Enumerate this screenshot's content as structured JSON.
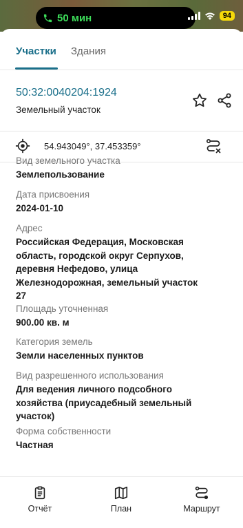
{
  "status_bar": {
    "call_time": "50 мин",
    "battery": "94"
  },
  "tabs": [
    {
      "label": "Участки",
      "active": true
    },
    {
      "label": "Здания",
      "active": false
    }
  ],
  "parcel": {
    "cadastral_number": "50:32:0040204:1924",
    "type": "Земельный участок"
  },
  "coordinates": "54.943049°, 37.453359°",
  "properties": [
    {
      "label": "Вид земельного участка",
      "value": "Землепользование"
    },
    {
      "label": "Дата присвоения",
      "value": "2024-01-10"
    },
    {
      "label": "Адрес",
      "value_lines": [
        "Российская Федерация, Московская",
        "область, городской округ Серпухов,",
        "деревня Нефедово, улица",
        "Железнодорожная, земельный участок",
        "27"
      ]
    },
    {
      "label": "Площадь уточненная",
      "value": "900.00 кв. м"
    },
    {
      "label": "Категория земель",
      "value": "Земли населенных пунктов"
    },
    {
      "label": "Вид разрешенного использования",
      "value_lines": [
        "Для ведения личного подсобного",
        "хозяйства (приусадебный земельный",
        "участок)"
      ]
    },
    {
      "label": "Форма собственности",
      "value": "Частная"
    }
  ],
  "bottom_nav": [
    {
      "label": "Отчёт",
      "icon": "report-icon"
    },
    {
      "label": "План",
      "icon": "map-icon"
    },
    {
      "label": "Маршрут",
      "icon": "route-icon"
    }
  ],
  "colors": {
    "accent": "#1a6f8a",
    "call_green": "#3ddc5a",
    "battery_yellow": "#f5d90a"
  }
}
